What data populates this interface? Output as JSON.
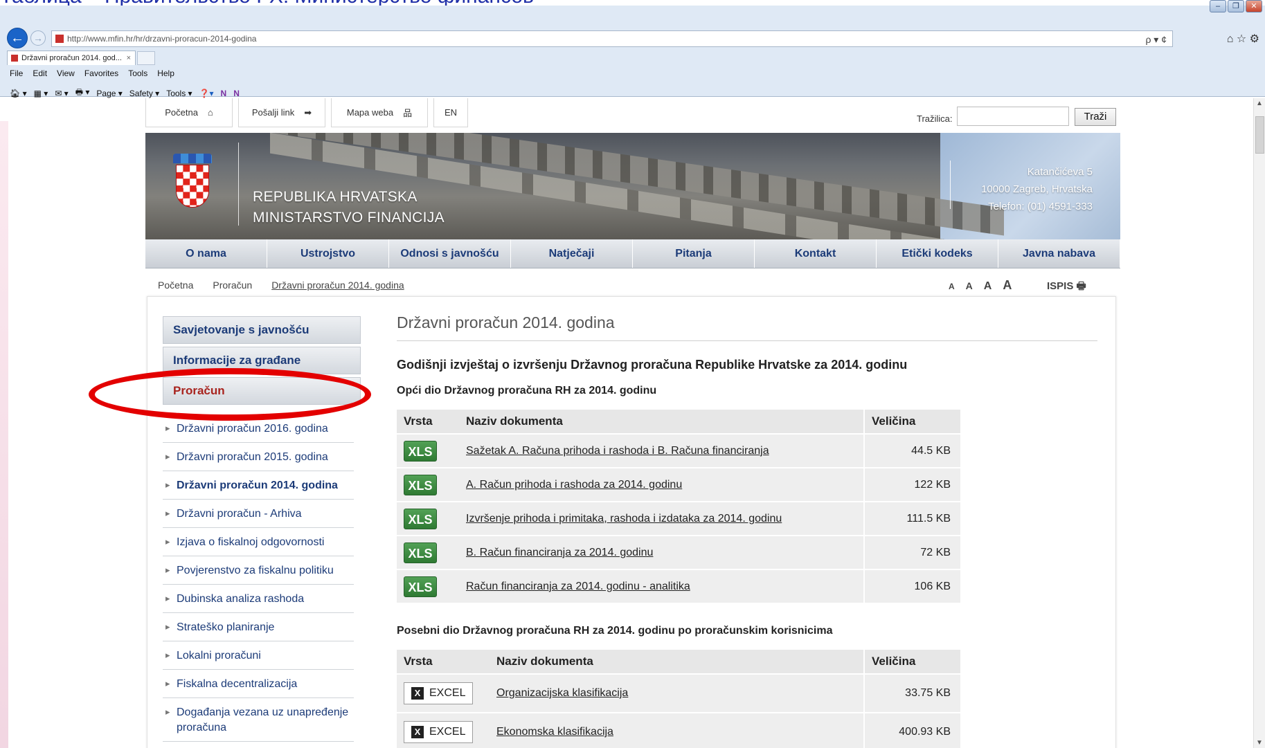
{
  "slide_title": "Таблица – Правительство РХ: Министерство финансов",
  "browser": {
    "url": "http://www.mfin.hr/hr/drzavni-proracun-2014-godina",
    "tab_title": "Državni proračun 2014. god...",
    "tab_close": "×",
    "menu": [
      "File",
      "Edit",
      "View",
      "Favorites",
      "Tools",
      "Help"
    ],
    "commands": [
      "Page ▾",
      "Safety ▾",
      "Tools ▾"
    ],
    "addr_tools": "ρ ▾ ¢",
    "right_icons": "⌂ ☆ ⚙",
    "win_min": "–",
    "win_max": "❐",
    "win_close": "✕"
  },
  "site": {
    "topnav": [
      {
        "label": "Početna",
        "icon": "⌂"
      },
      {
        "label": "Pošalji link",
        "icon": "➡"
      },
      {
        "label": "Mapa weba",
        "icon": "品"
      },
      {
        "label": "EN",
        "icon": ""
      }
    ],
    "search_label": "Tražilica:",
    "search_value": "",
    "search_button": "Traži",
    "banner_line1": "REPUBLIKA HRVATSKA",
    "banner_line2": "MINISTARSTVO FINANCIJA",
    "address": [
      "Katančićeva 5",
      "10000 Zagreb, Hrvatska",
      "Telefon: (01) 4591-333"
    ],
    "mainmenu": [
      "O nama",
      "Ustrojstvo",
      "Odnosi s javnošću",
      "Natječaji",
      "Pitanja",
      "Kontakt",
      "Etički kodeks",
      "Javna nabava"
    ],
    "breadcrumb": [
      "Početna",
      "Proračun",
      "Državni proračun 2014. godina"
    ],
    "font_sizes": [
      "A",
      "A",
      "A",
      "A"
    ],
    "print_label": "ISPIS",
    "print_icon": "🖶"
  },
  "sidebar": {
    "headers": [
      "Savjetovanje s javnošću",
      "Informacije za građane",
      "Proračun"
    ],
    "items": [
      "Državni proračun 2016. godina",
      "Državni proračun 2015. godina",
      "Državni proračun 2014. godina",
      "Državni proračun - Arhiva",
      "Izjava o fiskalnoj odgovornosti",
      "Povjerenstvo za fiskalnu politiku",
      "Dubinska analiza rashoda",
      "Strateško planiranje",
      "Lokalni proračuni",
      "Fiskalna decentralizacija",
      "Događanja vezana uz unapređenje proračuna"
    ],
    "selected_index": 2
  },
  "main": {
    "title": "Državni proračun 2014. godina",
    "section": "Godišnji izvještaj o izvršenju Državnog proračuna Republike Hrvatske za 2014. godinu",
    "sub1": "Opći dio Državnog proračuna RH za 2014. godinu",
    "sub2": "Posebni dio Državnog proračuna RH za 2014. godinu po proračunskim korisnicima",
    "col_type": "Vrsta",
    "col_name": "Naziv dokumenta",
    "col_size": "Veličina",
    "table1": [
      {
        "type": "XLS",
        "name": "Sažetak A. Računa prihoda i rashoda i B. Računa financiranja",
        "size": "44.5 KB"
      },
      {
        "type": "XLS",
        "name": "A. Račun prihoda i rashoda za 2014. godinu",
        "size": "122 KB"
      },
      {
        "type": "XLS",
        "name": "Izvršenje prihoda i primitaka, rashoda i izdataka za 2014. godinu",
        "size": "111.5 KB"
      },
      {
        "type": "XLS",
        "name": "B. Račun financiranja za 2014. godinu",
        "size": "72 KB"
      },
      {
        "type": "XLS",
        "name": "Račun financiranja za 2014. godinu - analitika",
        "size": "106 KB"
      }
    ],
    "table2": [
      {
        "type": "EXCEL",
        "name": "Organizacijska klasifikacija",
        "size": "33.75 KB"
      },
      {
        "type": "EXCEL",
        "name": "Ekonomska klasifikacija",
        "size": "400.93 KB"
      }
    ]
  }
}
